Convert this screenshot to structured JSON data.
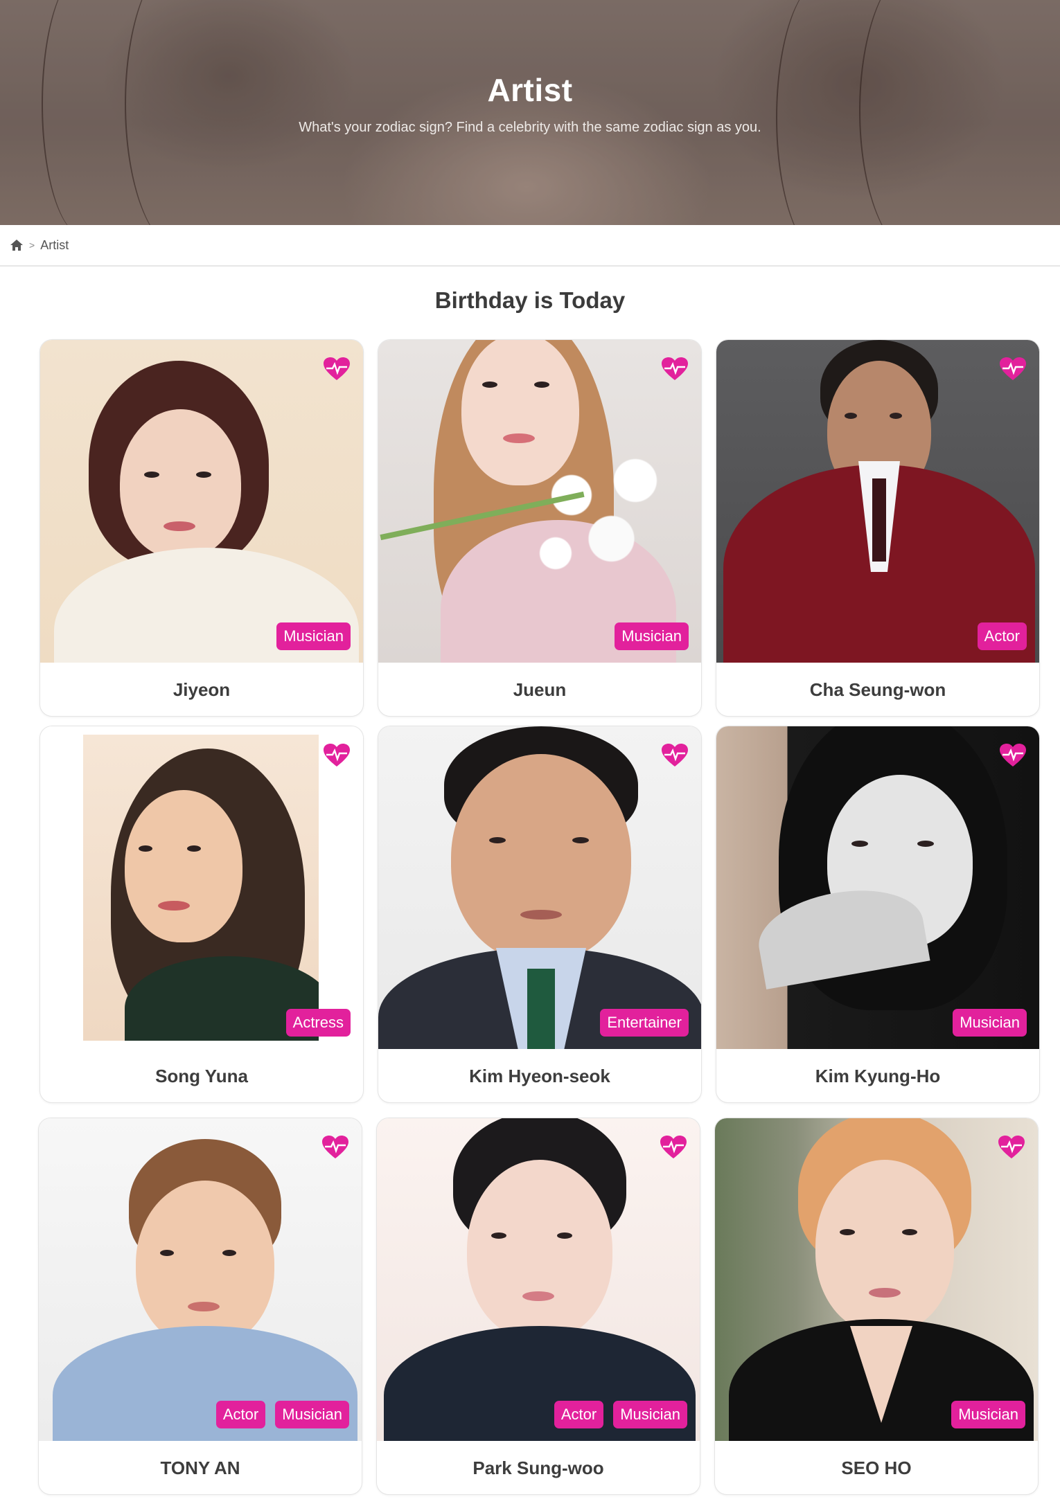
{
  "hero": {
    "title": "Artist",
    "subtitle": "What's your zodiac sign? Find a celebrity with the same zodiac sign as you."
  },
  "breadcrumb": {
    "home_icon": "home-icon",
    "separator": ">",
    "current": "Artist"
  },
  "section": {
    "title": "Birthday is Today"
  },
  "colors": {
    "accent": "#e2219c",
    "heart": "#e2219c"
  },
  "artists": [
    {
      "name": "Jiyeon",
      "tags": [
        "Musician"
      ]
    },
    {
      "name": "Jueun",
      "tags": [
        "Musician"
      ]
    },
    {
      "name": "Cha Seung-won",
      "tags": [
        "Actor"
      ]
    },
    {
      "name": "Song Yuna",
      "tags": [
        "Actress"
      ]
    },
    {
      "name": "Kim Hyeon-seok",
      "tags": [
        "Entertainer"
      ]
    },
    {
      "name": "Kim Kyung-Ho",
      "tags": [
        "Musician"
      ]
    },
    {
      "name": "TONY AN",
      "tags": [
        "Actor",
        "Musician"
      ]
    },
    {
      "name": "Park Sung-woo",
      "tags": [
        "Actor",
        "Musician"
      ]
    },
    {
      "name": "SEO HO",
      "tags": [
        "Musician"
      ]
    }
  ]
}
